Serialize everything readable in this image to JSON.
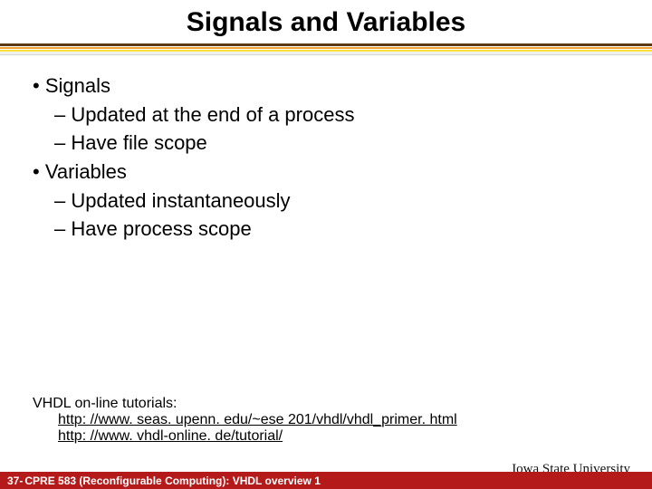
{
  "title": "Signals and Variables",
  "body": {
    "items": [
      {
        "level": 1,
        "text": "Signals"
      },
      {
        "level": 2,
        "text": "Updated at the end of a process"
      },
      {
        "level": 2,
        "text": "Have file scope"
      },
      {
        "level": 1,
        "text": "Variables"
      },
      {
        "level": 2,
        "text": "Updated instantaneously"
      },
      {
        "level": 2,
        "text": "Have process scope"
      }
    ]
  },
  "tutorials": {
    "heading": "VHDL on-line tutorials:",
    "links": [
      "http: //www. seas. upenn. edu/~ese 201/vhdl/vhdl_primer. html",
      "http: //www. vhdl-online. de/tutorial/"
    ]
  },
  "footer": {
    "page": "37",
    "separator": " - ",
    "course": "CPRE 583 (Reconfigurable Computing):  VHDL overview 1"
  },
  "university": "Iowa State University"
}
